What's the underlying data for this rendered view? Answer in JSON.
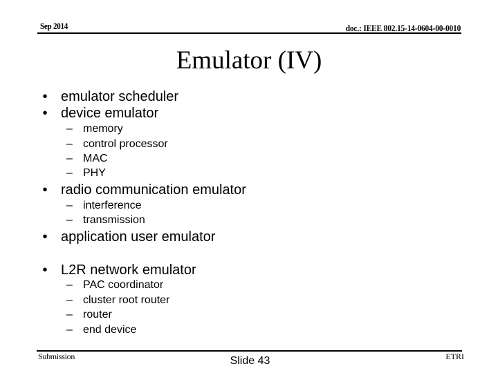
{
  "header": {
    "date": "Sep 2014",
    "doc_id": "doc.: IEEE 802.15-14-0604-00-0010"
  },
  "title": "Emulator (IV)",
  "bullets": [
    {
      "marker": "•",
      "text": "emulator scheduler",
      "children": []
    },
    {
      "marker": "•",
      "text": "device emulator",
      "children": [
        {
          "marker": "–",
          "text": "memory"
        },
        {
          "marker": "–",
          "text": "control processor"
        },
        {
          "marker": "–",
          "text": "MAC"
        },
        {
          "marker": "–",
          "text": "PHY"
        }
      ]
    },
    {
      "marker": "•",
      "text": "radio communication emulator",
      "children": [
        {
          "marker": "–",
          "text": "interference"
        },
        {
          "marker": "–",
          "text": "transmission"
        }
      ]
    },
    {
      "marker": "•",
      "text": "application user emulator",
      "children": []
    },
    {
      "marker": "•",
      "text": "L2R network emulator",
      "children": [
        {
          "marker": "–",
          "text": "PAC coordinator"
        },
        {
          "marker": "–",
          "text": "cluster root router"
        },
        {
          "marker": "–",
          "text": "router"
        },
        {
          "marker": "–",
          "text": "end device"
        }
      ]
    }
  ],
  "footer": {
    "left": "Submission",
    "center": "Slide 43",
    "right": "ETRI"
  }
}
